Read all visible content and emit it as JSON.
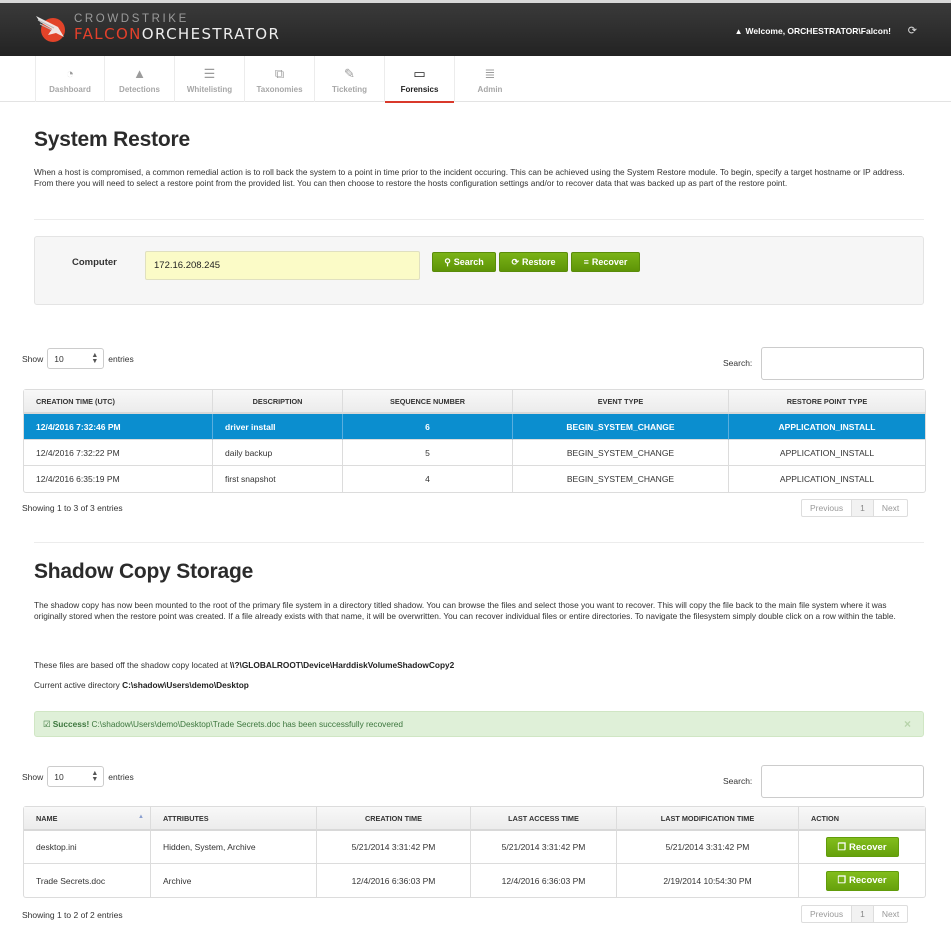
{
  "header": {
    "brand_top": "CROWDSTRIKE",
    "brand_falcon": "FALCON",
    "brand_orchestrator": "ORCHESTRATOR",
    "welcome": "Welcome, ORCHESTRATOR\\Falcon!",
    "user_icon": "user-icon",
    "refresh_icon": "refresh-icon"
  },
  "nav": {
    "items": [
      {
        "label": "Dashboard",
        "icon": "dashboard-icon",
        "glyph": "◔"
      },
      {
        "label": "Detections",
        "icon": "warning-icon",
        "glyph": "▲"
      },
      {
        "label": "Whitelisting",
        "icon": "list-icon",
        "glyph": "☰"
      },
      {
        "label": "Taxonomies",
        "icon": "taxonomy-icon",
        "glyph": "⧉"
      },
      {
        "label": "Ticketing",
        "icon": "ticket-icon",
        "glyph": "✎"
      },
      {
        "label": "Forensics",
        "icon": "monitor-icon",
        "glyph": "▭",
        "active": true
      },
      {
        "label": "Admin",
        "icon": "database-icon",
        "glyph": "≣"
      }
    ]
  },
  "system_restore": {
    "title": "System Restore",
    "description": "When a host is compromised, a common remedial action is to roll back the system to a point in time prior to the incident occuring. This can be achieved using the System Restore module. To begin, specify a target hostname or IP address. From there you will need to select a restore point from the provided list. You can then choose to restore the hosts configuration settings and/or to recover data that was backed up as part of the restore point.",
    "computer_label": "Computer",
    "computer_value": "172.16.208.245",
    "buttons": {
      "search": "Search",
      "restore": "Restore",
      "recover": "Recover"
    },
    "table": {
      "show_label": "Show",
      "entries_label": "entries",
      "page_size": "10",
      "search_label": "Search:",
      "search_value": "",
      "columns": [
        "CREATION TIME (UTC)",
        "DESCRIPTION",
        "SEQUENCE NUMBER",
        "EVENT TYPE",
        "RESTORE POINT TYPE"
      ],
      "rows": [
        {
          "creation_time": "12/4/2016 7:32:46 PM",
          "description": "driver install",
          "sequence": "6",
          "event_type": "BEGIN_SYSTEM_CHANGE",
          "restore_type": "APPLICATION_INSTALL",
          "selected": true
        },
        {
          "creation_time": "12/4/2016 7:32:22 PM",
          "description": "daily backup",
          "sequence": "5",
          "event_type": "BEGIN_SYSTEM_CHANGE",
          "restore_type": "APPLICATION_INSTALL"
        },
        {
          "creation_time": "12/4/2016 6:35:19 PM",
          "description": "first snapshot",
          "sequence": "4",
          "event_type": "BEGIN_SYSTEM_CHANGE",
          "restore_type": "APPLICATION_INSTALL"
        }
      ],
      "info": "Showing 1 to 3 of 3 entries",
      "pager": {
        "previous": "Previous",
        "page": "1",
        "next": "Next"
      }
    }
  },
  "shadow_copy": {
    "title": "Shadow Copy Storage",
    "description": "The shadow copy has now been mounted to the root of the primary file system in a directory titled shadow. You can browse the files and select those you want to recover. This will copy the file back to the main file system where it was originally stored when the restore point was created. If a file already exists with that name, it will be overwritten. You can recover individual files or entire directories. To navigate the filesystem simply double click on a row within the table.",
    "location_prefix": "These files are based off the shadow copy located at ",
    "location_value": "\\\\?\\GLOBALROOT\\Device\\HarddiskVolumeShadowCopy2",
    "directory_prefix": "Current active directory ",
    "directory_value": "C:\\shadow\\Users\\demo\\Desktop",
    "alert": {
      "strong": "Success!",
      "message": " C:\\shadow\\Users\\demo\\Desktop\\Trade Secrets.doc has been successfully recovered",
      "close": "×"
    },
    "table": {
      "show_label": "Show",
      "entries_label": "entries",
      "page_size": "10",
      "search_label": "Search:",
      "search_value": "",
      "columns": [
        "NAME",
        "ATTRIBUTES",
        "CREATION TIME",
        "LAST ACCESS TIME",
        "LAST MODIFICATION TIME",
        "ACTION"
      ],
      "sort_indicator": "▲",
      "rows": [
        {
          "name": "desktop.ini",
          "attributes": "Hidden, System, Archive",
          "created": "5/21/2014 3:31:42 PM",
          "accessed": "5/21/2014 3:31:42 PM",
          "modified": "5/21/2014 3:31:42 PM",
          "action": "Recover"
        },
        {
          "name": "Trade Secrets.doc",
          "attributes": "Archive",
          "created": "12/4/2016 6:36:03 PM",
          "accessed": "12/4/2016 6:36:03 PM",
          "modified": "2/19/2014 10:54:30 PM",
          "action": "Recover"
        }
      ],
      "info": "Showing 1 to 2 of 2 entries",
      "pager": {
        "previous": "Previous",
        "page": "1",
        "next": "Next"
      }
    }
  },
  "colors": {
    "accent_red": "#d9392b",
    "selected_row": "#0b8ecf",
    "button_green": "#6ea712",
    "input_highlight": "#fbfbc7",
    "success_bg": "#dff0d8"
  }
}
